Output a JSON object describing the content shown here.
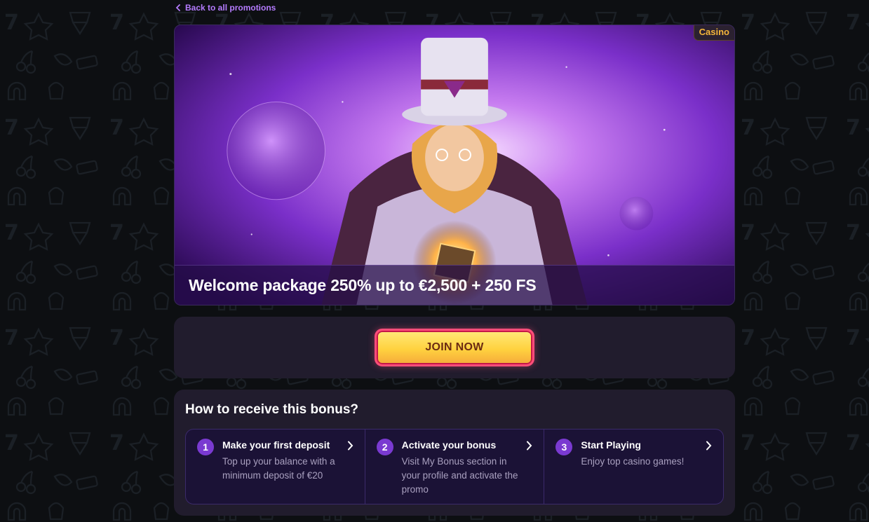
{
  "nav": {
    "back_label": "Back to all promotions"
  },
  "hero": {
    "badge": "Casino",
    "title": "Welcome package 250% up to €2,500 + 250 FS"
  },
  "cta": {
    "join_label": "JOIN NOW"
  },
  "how": {
    "title": "How to receive this bonus?",
    "steps": [
      {
        "number": "1",
        "title": "Make your first deposit",
        "description": "Top up your balance with a minimum deposit of €20"
      },
      {
        "number": "2",
        "title": "Activate your bonus",
        "description": "Visit My Bonus section in your profile and activate the promo"
      },
      {
        "number": "3",
        "title": "Start Playing",
        "description": "Enjoy top casino games!"
      }
    ]
  },
  "colors": {
    "accent": "#b57cff",
    "badge_text": "#f4b63a",
    "panel": "#211c2d",
    "button": "#ffd23f",
    "button_border": "#ff4d7a",
    "step_number": "#7a3ad1"
  },
  "icons": [
    "chevron-left-icon",
    "chevron-right-icon",
    "magician-illustration"
  ]
}
